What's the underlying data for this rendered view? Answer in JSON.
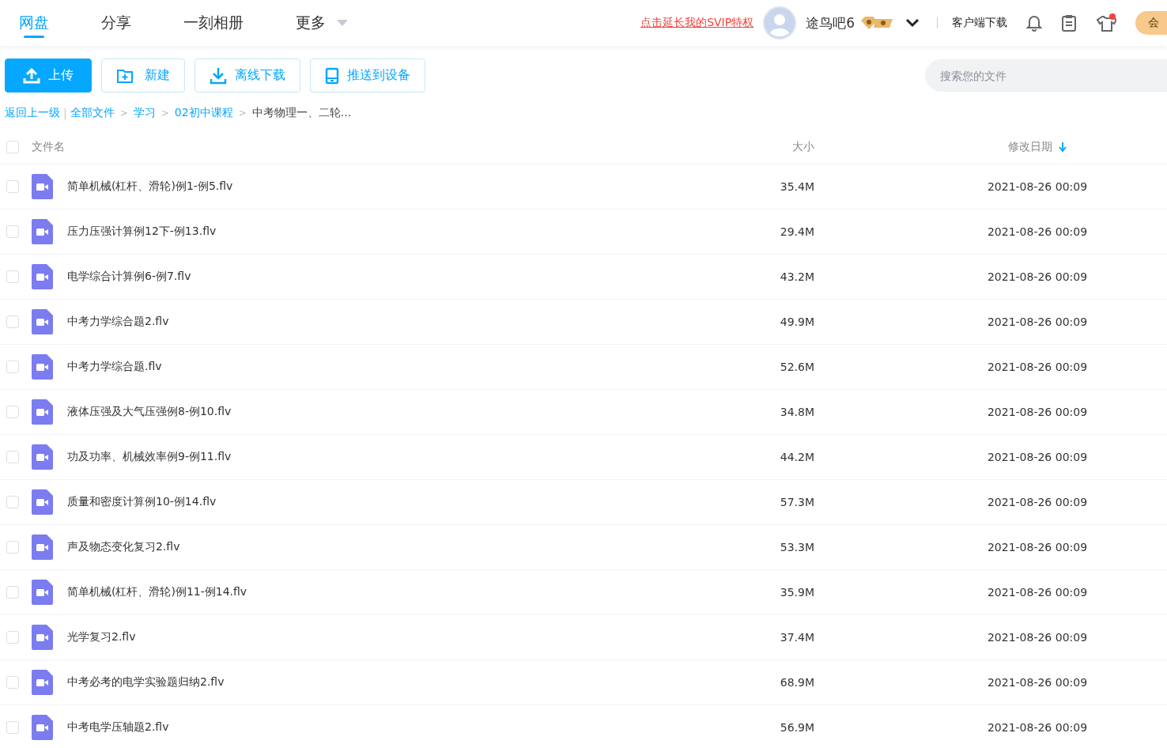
{
  "nav": {
    "tabs": [
      {
        "label": "网盘",
        "selected": true
      },
      {
        "label": "分享",
        "selected": false
      },
      {
        "label": "一刻相册",
        "selected": false
      },
      {
        "label": "更多",
        "selected": false
      }
    ],
    "promo_link": "点击延长我的SVIP特权",
    "user_name": "途鸟吧6",
    "client_download": "客户端下载",
    "member_button": "会"
  },
  "toolbar": {
    "buttons": [
      {
        "label": "上传",
        "kind": "primary"
      },
      {
        "label": "新建",
        "kind": "new"
      },
      {
        "label": "离线下载",
        "kind": "download"
      },
      {
        "label": "推送到设备",
        "kind": "device"
      }
    ],
    "search": {
      "placeholder": "搜索您的文件"
    }
  },
  "breadcrumb": {
    "back": "返回上一级",
    "back_separator": "|",
    "separator": ">",
    "items": [
      "全部文件",
      "学习",
      "02初中课程",
      "中考物理一、二轮..."
    ]
  },
  "table": {
    "columns": [
      "文件名",
      "大小",
      "修改日期"
    ],
    "select_all_checked": false,
    "rows": [
      {
        "name": "简单机械(杠杆、滑轮)例1-例5.flv",
        "size": "35.4M",
        "date": "2021-08-26 00:09",
        "checked": false
      },
      {
        "name": "压力压强计算例12下-例13.flv",
        "size": "29.4M",
        "date": "2021-08-26 00:09",
        "checked": false
      },
      {
        "name": "电学综合计算例6-例7.flv",
        "size": "43.2M",
        "date": "2021-08-26 00:09",
        "checked": false
      },
      {
        "name": "中考力学综合题2.flv",
        "size": "49.9M",
        "date": "2021-08-26 00:09",
        "checked": false
      },
      {
        "name": "中考力学综合题.flv",
        "size": "52.6M",
        "date": "2021-08-26 00:09",
        "checked": false
      },
      {
        "name": "液体压强及大气压强例8-例10.flv",
        "size": "34.8M",
        "date": "2021-08-26 00:09",
        "checked": false
      },
      {
        "name": "功及功率、机械效率例9-例11.flv",
        "size": "44.2M",
        "date": "2021-08-26 00:09",
        "checked": false
      },
      {
        "name": "质量和密度计算例10-例14.flv",
        "size": "57.3M",
        "date": "2021-08-26 00:09",
        "checked": false
      },
      {
        "name": "声及物态变化复习2.flv",
        "size": "53.3M",
        "date": "2021-08-26 00:09",
        "checked": false
      },
      {
        "name": "简单机械(杠杆、滑轮)例11-例14.flv",
        "size": "35.9M",
        "date": "2021-08-26 00:09",
        "checked": false
      },
      {
        "name": "光学复习2.flv",
        "size": "37.4M",
        "date": "2021-08-26 00:09",
        "checked": false
      },
      {
        "name": "中考必考的电学实验题归纳2.flv",
        "size": "68.9M",
        "date": "2021-08-26 00:09",
        "checked": false
      },
      {
        "name": "中考电学压轴题2.flv",
        "size": "56.9M",
        "date": "2021-08-26 00:09",
        "checked": false
      }
    ]
  }
}
